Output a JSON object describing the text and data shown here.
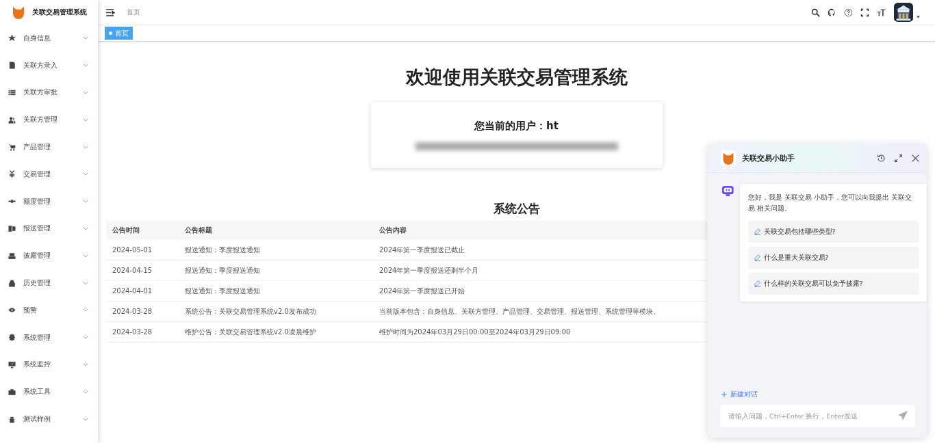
{
  "app": {
    "title": "关联交易管理系统"
  },
  "sidebar": {
    "items": [
      {
        "label": "自身信息",
        "expanded": false
      },
      {
        "label": "关联方录入",
        "expanded": false
      },
      {
        "label": "关联方审批",
        "expanded": false
      },
      {
        "label": "关联方管理",
        "expanded": false
      },
      {
        "label": "产品管理",
        "expanded": false
      },
      {
        "label": "交易管理",
        "expanded": false
      },
      {
        "label": "额度管理",
        "expanded": false
      },
      {
        "label": "报送管理",
        "expanded": false
      },
      {
        "label": "披露管理",
        "expanded": false
      },
      {
        "label": "历史管理",
        "expanded": false
      },
      {
        "label": "预警",
        "expanded": false
      },
      {
        "label": "系统管理",
        "expanded": false
      },
      {
        "label": "系统监控",
        "expanded": false
      },
      {
        "label": "系统工具",
        "expanded": false
      },
      {
        "label": "测试样例",
        "expanded": false
      }
    ]
  },
  "breadcrumb": [
    "首页"
  ],
  "tags": [
    {
      "label": "首页",
      "selected": true
    }
  ],
  "welcome": {
    "heading": "欢迎使用关联交易管理系统",
    "user_line": "您当前的用户：ht"
  },
  "announcements": {
    "title": "系统公告",
    "columns": [
      "公告时间",
      "公告标题",
      "公告内容"
    ],
    "rows": [
      [
        "2024-05-01",
        "报送通知：季度报送通知",
        "2024年第一季度报送已截止"
      ],
      [
        "2024-04-15",
        "报送通知：季度报送通知",
        "2024年第一季度报送还剩半个月"
      ],
      [
        "2024-04-01",
        "报送通知：季度报送通知",
        "2024年第一季度报送已开始"
      ],
      [
        "2024-03-28",
        "系统公告：关联交易管理系统v2.0发布成功",
        "当前版本包含：自身信息、关联方管理、产品管理、交易管理、报送管理、系统管理等模块。"
      ],
      [
        "2024-03-28",
        "维护公告：关联交易管理系统v2.0凌晨维护",
        "维护时间为2024年03月29日00:00至2024年03月29日09:00"
      ]
    ]
  },
  "assistant": {
    "title": "关联交易小助手",
    "greeting": "您好，我是 关联交易 小助手，您可以向我提出 关联交易 相关问题。",
    "suggestions": [
      "关联交易包括哪些类型?",
      "什么是重大关联交易?",
      "什么样的关联交易可以免予披露?"
    ],
    "new_chat": "新建对话",
    "input": {
      "placeholder": "请输入问题，Ctrl+Enter 换行，Enter发送"
    }
  }
}
